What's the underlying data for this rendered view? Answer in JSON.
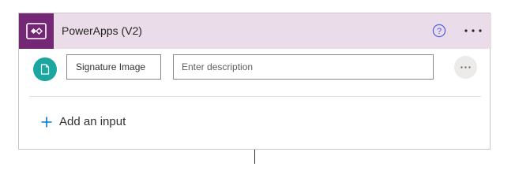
{
  "header": {
    "app_icon": "powerapps-icon",
    "title": "PowerApps (V2)",
    "help_icon": "help-circle-icon",
    "more_icon": "more-horizontal-icon",
    "header_color": "#ebdcea",
    "icon_bg_color": "#742774"
  },
  "inputs": [
    {
      "type_icon": "file-icon",
      "badge_color": "#1ba6a0",
      "name": "Signature Image",
      "description_value": "",
      "description_placeholder": "Enter description",
      "options_icon": "more-horizontal-icon"
    }
  ],
  "add_input": {
    "icon": "plus-icon",
    "label": "Add an input",
    "accent_color": "#0078d4"
  }
}
